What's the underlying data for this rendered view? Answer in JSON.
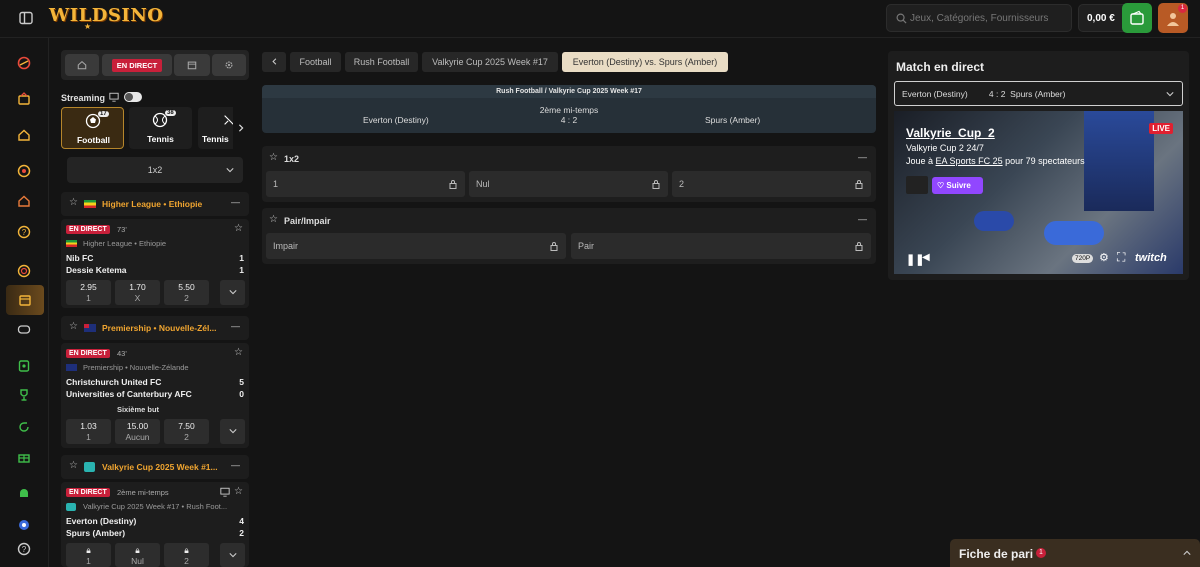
{
  "app": {
    "logo": "WILDSINO"
  },
  "header": {
    "search_placeholder": "Jeux, Catégories, Fournisseurs",
    "balance": "0,00 €",
    "notif_count": "1"
  },
  "sidebar": {
    "icons": [
      "sport-icon",
      "casino-icon",
      "home-icon",
      "poker-icon",
      "home-alt-icon",
      "help-icon",
      "roulette-icon",
      "calendar-icon",
      "gamepad-icon",
      "bonus-icon",
      "trophy-icon",
      "refresh-icon",
      "gift-icon",
      "android-icon",
      "chrome-icon",
      "support-icon"
    ]
  },
  "left": {
    "tabs": {
      "live": "EN DIRECT"
    },
    "streaming_label": "Streaming",
    "sports": [
      {
        "label": "Football",
        "count": "17"
      },
      {
        "label": "Tennis",
        "count": "38"
      },
      {
        "label": "Tennis"
      }
    ],
    "market_select": "1x2",
    "leagues": [
      {
        "title": "Higher League • Ethiopie",
        "live": "EN DIRECT",
        "time": "73'",
        "sub": "Higher League • Ethiopie",
        "home": "Nib FC",
        "away": "Dessie Ketema",
        "home_score": "1",
        "away_score": "1",
        "odds": [
          {
            "v": "2.95",
            "l": "1"
          },
          {
            "v": "1.70",
            "l": "X"
          },
          {
            "v": "5.50",
            "l": "2"
          }
        ]
      },
      {
        "title": "Premiership • Nouvelle-Zél...",
        "live": "EN DIRECT",
        "time": "43'",
        "sub": "Premiership • Nouvelle-Zélande",
        "home": "Christchurch United FC",
        "away": "Universities of Canterbury AFC",
        "home_score": "5",
        "away_score": "0",
        "market": "Sixième but",
        "odds": [
          {
            "v": "1.03",
            "l": "1"
          },
          {
            "v": "15.00",
            "l": "Aucun"
          },
          {
            "v": "7.50",
            "l": "2"
          }
        ]
      },
      {
        "title": "Valkyrie Cup 2025 Week #1...",
        "live": "EN DIRECT",
        "time": "2ème mi-temps",
        "sub": "Valkyrie Cup 2025 Week #17 • Rush Foot...",
        "home": "Everton (Destiny)",
        "away": "Spurs (Amber)",
        "home_score": "4",
        "away_score": "2",
        "odds": [
          {
            "l": "1"
          },
          {
            "l": "Nul"
          },
          {
            "l": "2"
          }
        ]
      }
    ]
  },
  "breadcrumb": [
    "Football",
    "Rush Football",
    "Valkyrie Cup 2025 Week #17",
    "Everton (Destiny) vs. Spurs (Amber)"
  ],
  "match": {
    "competition": "Rush Football / Valkyrie Cup 2025 Week #17",
    "home": "Everton (Destiny)",
    "away": "Spurs (Amber)",
    "period": "2ème mi-temps",
    "score": "4 : 2"
  },
  "markets": [
    {
      "title": "1x2",
      "cells": [
        "1",
        "Nul",
        "2"
      ]
    },
    {
      "title": "Pair/Impair",
      "cells": [
        "Impair",
        "Pair"
      ]
    }
  ],
  "right": {
    "title": "Match en direct",
    "select": "Everton (Destiny)         4 : 2  Spurs (Amber)",
    "stream": {
      "channel": "Valkyrie_Cup_2",
      "subtitle": "Valkyrie Cup 2 24/7",
      "plays_prefix": "Joue à",
      "game": "EA Sports FC 25",
      "plays_suffix": "pour 79 spectateurs",
      "live": "LIVE",
      "follow": "Suivre",
      "quality": "720P",
      "brand": "twitch"
    }
  },
  "betslip": {
    "label": "Fiche de pari",
    "count": "1"
  },
  "colors": {
    "accent": "#f0a530",
    "live": "#c8203a",
    "bg": "#141414"
  }
}
